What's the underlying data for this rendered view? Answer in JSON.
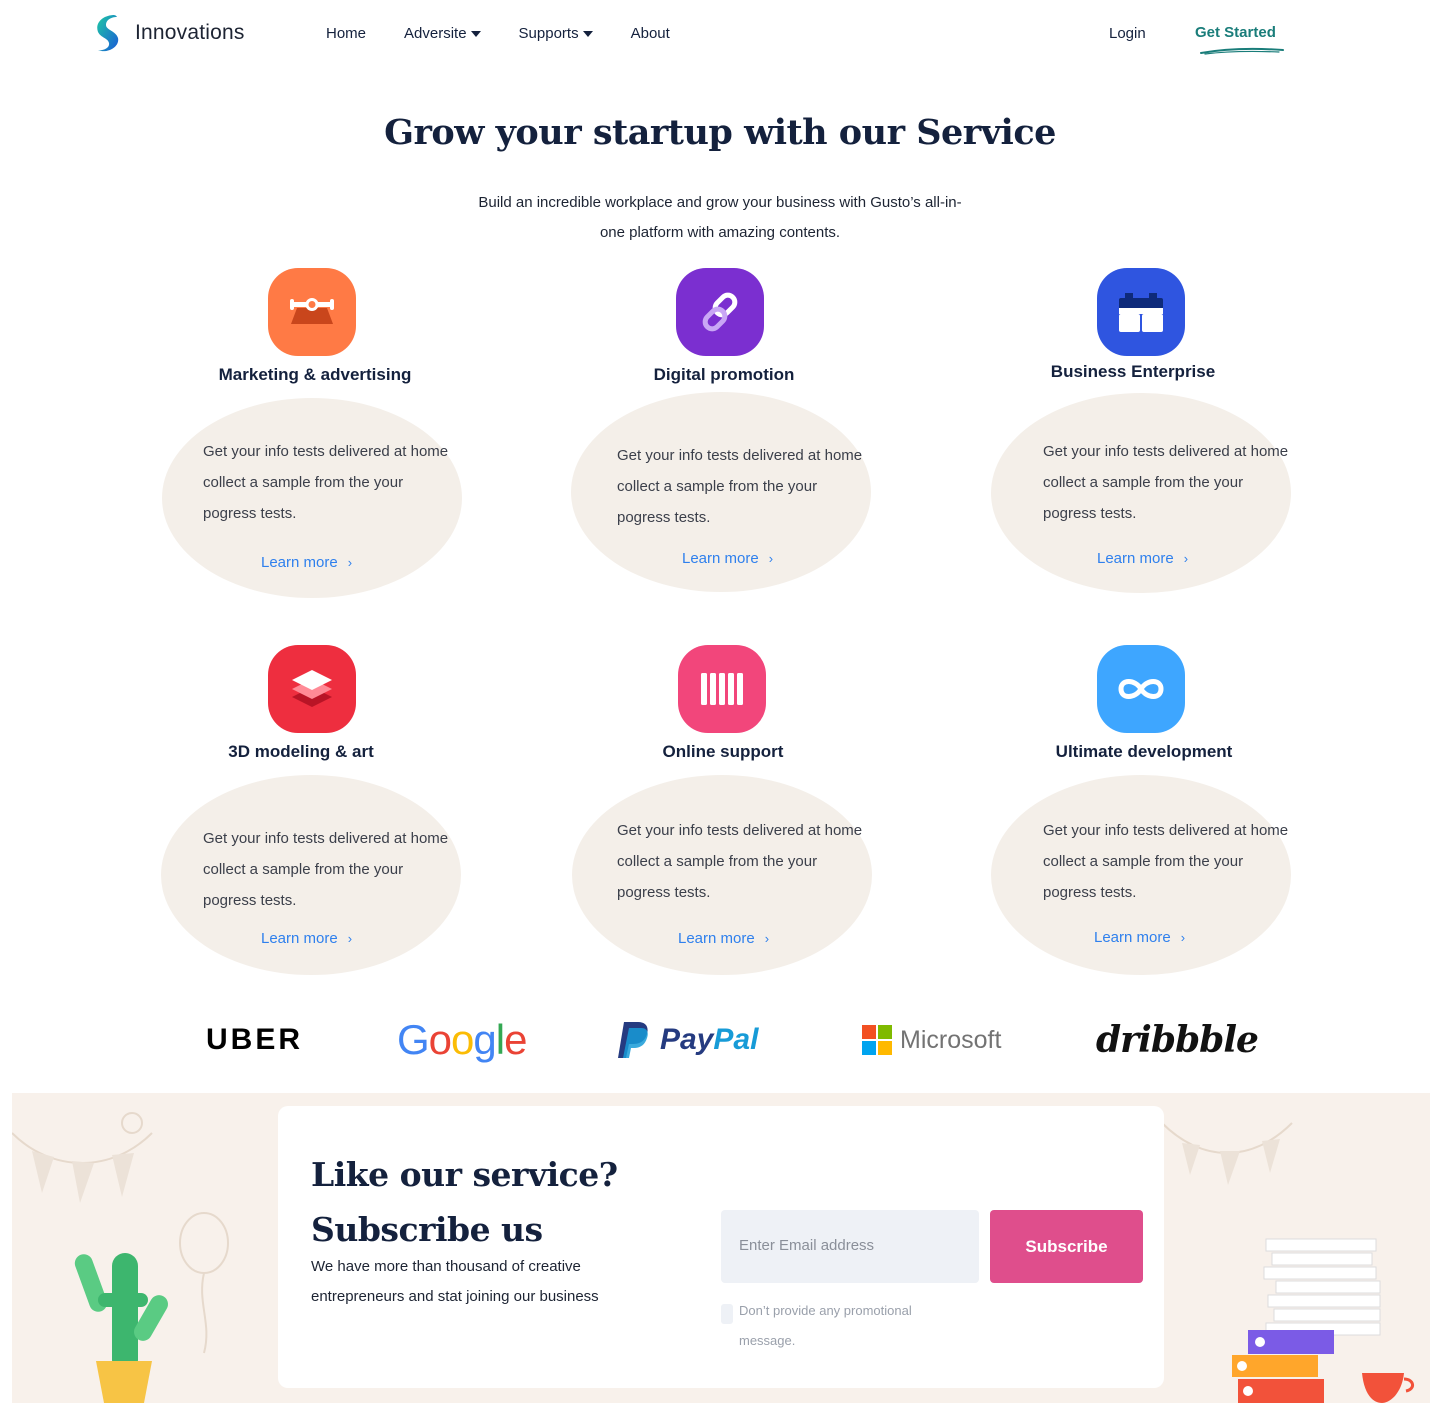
{
  "nav": {
    "brand": "Innovations",
    "links": [
      {
        "label": "Home",
        "dropdown": false
      },
      {
        "label": "Adversite",
        "dropdown": true
      },
      {
        "label": "Supports",
        "dropdown": true
      },
      {
        "label": "About",
        "dropdown": false
      }
    ],
    "login": "Login",
    "get_started": "Get Started"
  },
  "hero": {
    "title": "Grow your startup with our Service",
    "subtitle": "Build an incredible workplace and grow your business with Gusto’s all-in-one platform with amazing contents."
  },
  "services": [
    {
      "title": "Marketing & advertising",
      "icon": "toolbox-icon",
      "color": "#ff7a45",
      "text": "Get your info tests delivered at home collect a sample from the your pogress tests.",
      "link": "Learn more"
    },
    {
      "title": "Digital promotion",
      "icon": "link-icon",
      "color": "#7b2fd0",
      "text": "Get your info tests delivered at home collect a sample from the your pogress tests.",
      "link": "Learn more"
    },
    {
      "title": "Business Enterprise",
      "icon": "building-blocks-icon",
      "color": "#2f55e0",
      "text": "Get your info tests delivered at home collect a sample from the your pogress tests.",
      "link": "Learn more"
    },
    {
      "title": "3D modeling & art",
      "icon": "layers-icon",
      "color": "#ee2e3f",
      "text": "Get your info tests delivered at home collect a sample from the your pogress tests.",
      "link": "Learn more"
    },
    {
      "title": "Online support",
      "icon": "bars-icon",
      "color": "#f2467b",
      "text": "Get your info tests delivered at home collect a sample from the your pogress tests.",
      "link": "Learn more"
    },
    {
      "title": "Ultimate development",
      "icon": "infinity-icon",
      "color": "#3ea6ff",
      "text": "Get your info tests delivered at home collect a sample from the your pogress tests.",
      "link": "Learn more"
    }
  ],
  "brands": [
    "UBER",
    "Google",
    "PayPal",
    "Microsoft",
    "dribbble"
  ],
  "subscribe": {
    "title": "Like our service? Subscribe us",
    "text": "We have more than thousand of creative entrepreneurs and stat joining our business",
    "email_placeholder": "Enter Email address",
    "button": "Subscribe",
    "checkbox_label": "Don’t provide any promotional message."
  }
}
